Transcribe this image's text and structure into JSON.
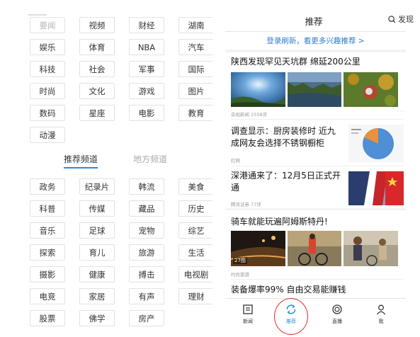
{
  "left": {
    "my_channels": [
      "要闻",
      "视频",
      "财经",
      "湖南",
      "娱乐",
      "体育",
      "NBA",
      "汽车",
      "科技",
      "社会",
      "军事",
      "国际",
      "时尚",
      "文化",
      "游戏",
      "图片",
      "数码",
      "星座",
      "电影",
      "教育",
      "动漫"
    ],
    "tabs": {
      "recommended": "推荐频道",
      "local": "地方频道"
    },
    "recommended_channels": [
      "政务",
      "纪录片",
      "韩流",
      "美食",
      "科普",
      "传媒",
      "藏品",
      "历史",
      "音乐",
      "足球",
      "宠物",
      "综艺",
      "探索",
      "育儿",
      "旅游",
      "生活",
      "摄影",
      "健康",
      "搏击",
      "电视剧",
      "电竞",
      "家居",
      "有声",
      "理财",
      "股票",
      "佛学",
      "房产"
    ]
  },
  "right": {
    "header": {
      "title": "推荐",
      "search_label": "发现"
    },
    "login_prompt": "登录刷新，看更多兴趣推荐 >",
    "articles": [
      {
        "title": "陕西发现罕见天坑群 绵延200公里",
        "source": "央视新闻",
        "comments": "2558评"
      },
      {
        "title_line1": "调查显示：厨房装修时 近九",
        "title_line2": "成网友会选择不锈钢橱柜",
        "source": "红网"
      },
      {
        "title_line1": "深港通来了：12月5日正式开",
        "title_line2": "通",
        "source": "腾讯证券",
        "comments": "77评"
      },
      {
        "title": "骑车就能玩遍阿姆斯特丹!",
        "source": "时尚旅游",
        "image_count": "27图"
      },
      {
        "title": "装备爆率99% 自由交易能赚钱"
      }
    ],
    "more": "···",
    "bottom_nav": [
      {
        "label": "新闻",
        "icon": "news-icon"
      },
      {
        "label": "推荐",
        "icon": "refresh-icon"
      },
      {
        "label": "直播",
        "icon": "live-icon"
      },
      {
        "label": "我",
        "icon": "profile-icon"
      }
    ],
    "colors": {
      "accent": "#2b8ce0",
      "highlight_circle": "#d9302e"
    }
  }
}
